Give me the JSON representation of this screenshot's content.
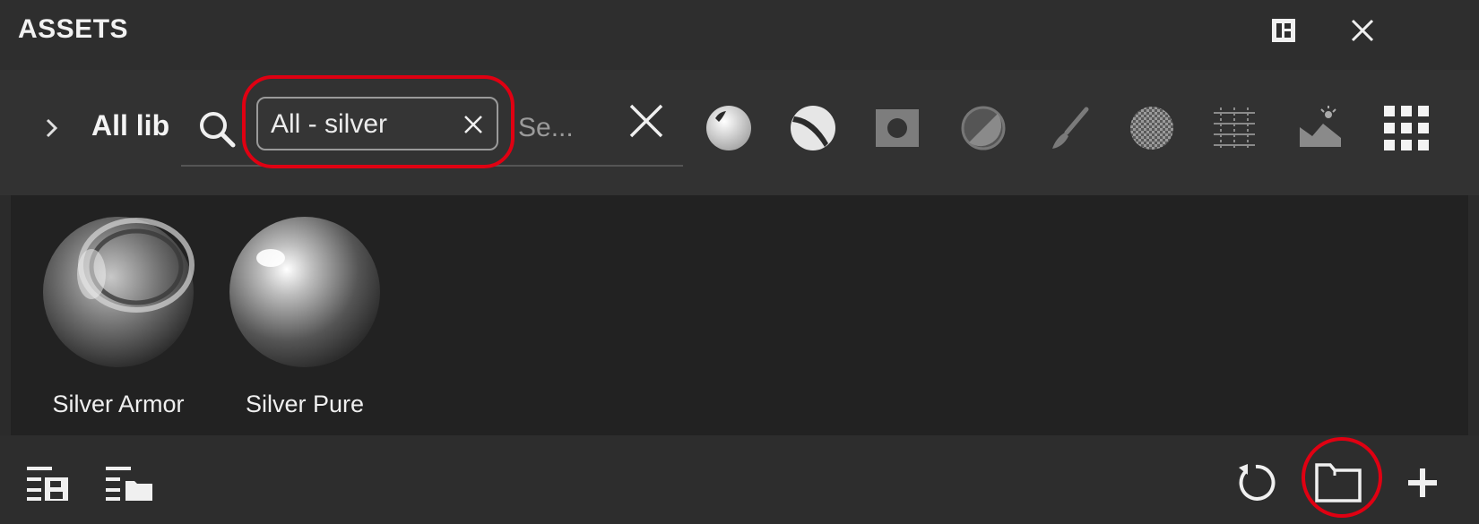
{
  "window": {
    "title": "ASSETS"
  },
  "titlebar_icons": {
    "layout": "layout-toggle-icon",
    "close": "close-icon"
  },
  "toolbar": {
    "expand_icon": "chevron-right-icon",
    "library_label": "All lib",
    "search_icon": "search-icon",
    "filter_chip": {
      "text": "All - silver",
      "remove_icon": "close-icon"
    },
    "search": {
      "placeholder": "Se...",
      "value": ""
    },
    "clear_icon": "clear-icon",
    "filters": [
      {
        "name": "smart-material-icon"
      },
      {
        "name": "smart-mask-icon"
      },
      {
        "name": "material-icon"
      },
      {
        "name": "generator-icon"
      },
      {
        "name": "brush-icon"
      },
      {
        "name": "alpha-icon"
      },
      {
        "name": "texture-icon"
      },
      {
        "name": "environment-icon"
      },
      {
        "name": "all-assets-grid-icon"
      }
    ]
  },
  "assets": [
    {
      "label": "Silver Armor"
    },
    {
      "label": "Silver Pure"
    }
  ],
  "bottom": {
    "left": [
      "save-list-icon",
      "folder-list-icon"
    ],
    "right": [
      "refresh-icon",
      "folder-icon",
      "add-icon"
    ]
  },
  "colors": {
    "highlight": "#e00012",
    "panel": "#2b2b2b",
    "grid_bg": "#222222"
  }
}
